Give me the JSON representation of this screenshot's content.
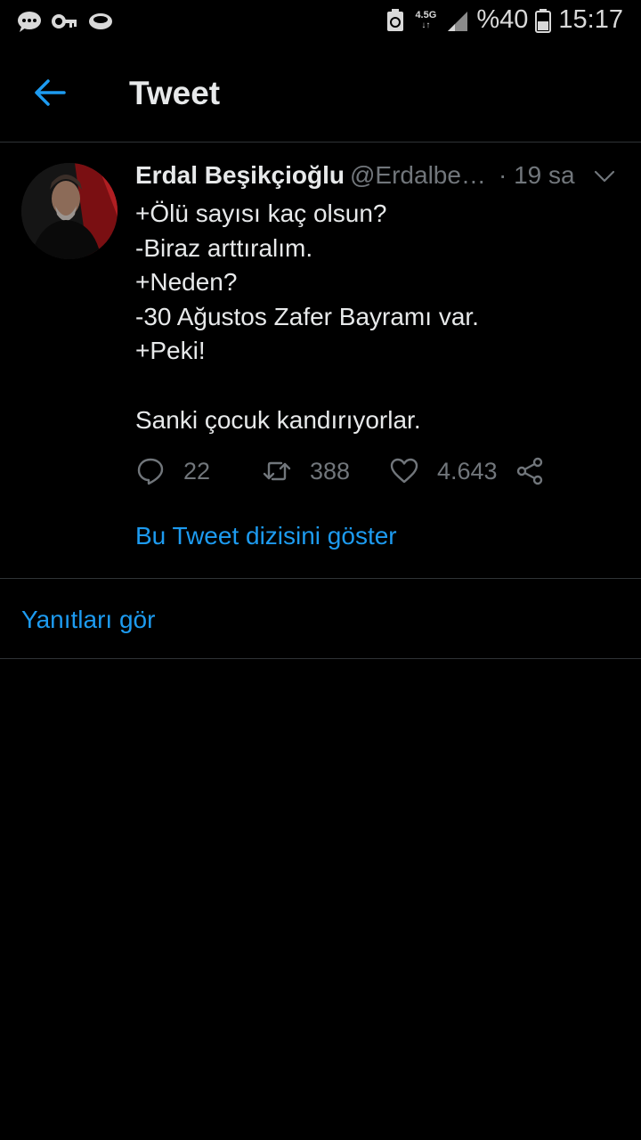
{
  "status_bar": {
    "battery": "%40",
    "time": "15:17",
    "network": "4.5G",
    "icons": [
      "chat-bubble-icon",
      "key-icon",
      "cloud-icon",
      "battery-saver-icon",
      "signal-icon",
      "battery-icon"
    ]
  },
  "header": {
    "title": "Tweet",
    "back_icon": "arrow-left-icon",
    "accent_color": "#1d9bf0"
  },
  "tweet": {
    "author_name": "Erdal Beşikçioğlu",
    "author_handle": "@Erdalbe…",
    "time": "· 19 sa",
    "lines": [
      "+Ölü sayısı kaç olsun?",
      "-Biraz arttıralım.",
      "+Neden?",
      "-30 Ağustos Zafer Bayramı var.",
      "+Peki!",
      "",
      "Sanki çocuk kandırıyorlar."
    ],
    "replies_count": "22",
    "retweets_count": "388",
    "likes_count": "4.643",
    "thread_link": "Bu Tweet dizisini göster"
  },
  "replies": {
    "link": "Yanıtları gör"
  }
}
